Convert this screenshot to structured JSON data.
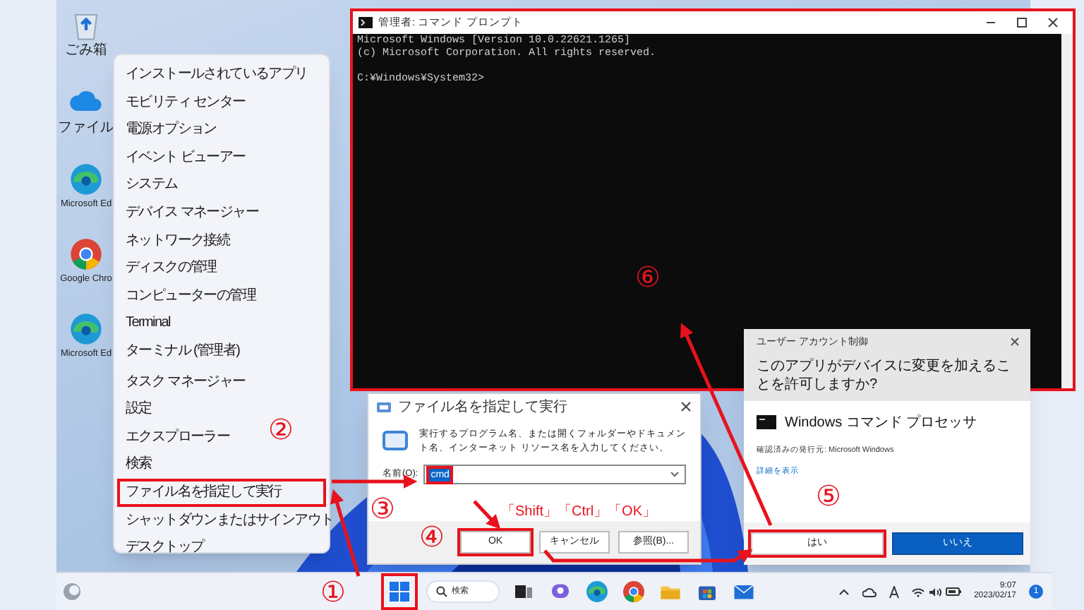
{
  "desktop_icons": [
    {
      "kind": "recycle",
      "label": "ごみ箱"
    },
    {
      "kind": "cloud",
      "label": "ファイル"
    },
    {
      "kind": "edge",
      "label": "Microsoft Ed"
    },
    {
      "kind": "chrome",
      "label": "Google Chro"
    },
    {
      "kind": "edge",
      "label": "Microsoft Ed"
    }
  ],
  "context_menu": {
    "sections": [
      [
        {
          "label": "インストールされているアプリ",
          "boxed": false
        },
        {
          "label": "モビリティ センター",
          "boxed": false
        },
        {
          "label": "電源オプション",
          "boxed": false
        },
        {
          "label": "イベント ビューアー",
          "boxed": false
        },
        {
          "label": "システム",
          "boxed": false
        },
        {
          "label": "デバイス マネージャー",
          "boxed": false
        },
        {
          "label": "ネットワーク接続",
          "boxed": false
        },
        {
          "label": "ディスクの管理",
          "boxed": false
        },
        {
          "label": "コンピューターの管理",
          "boxed": false
        },
        {
          "label": "Terminal",
          "boxed": false
        },
        {
          "label": "ターミナル (管理者)",
          "boxed": false
        }
      ],
      [
        {
          "label": "タスク マネージャー",
          "boxed": false
        },
        {
          "label": "設定",
          "boxed": false
        },
        {
          "label": "エクスプローラー",
          "boxed": false
        },
        {
          "label": "検索",
          "boxed": false
        },
        {
          "label": "ファイル名を指定して実行",
          "boxed": true
        },
        {
          "label": "シャットダウンまたはサインアウト",
          "boxed": false
        },
        {
          "label": "デスクトップ",
          "boxed": false
        }
      ]
    ]
  },
  "cmd_window": {
    "title": "管理者: コマンド プロンプト",
    "boxed": true,
    "lines": [
      "Microsoft Windows [Version 10.0.22621.1265]",
      "(c) Microsoft Corporation. All rights reserved."
    ],
    "prompt": "C:¥Windows¥System32>"
  },
  "run_dialog": {
    "title": "ファイル名を指定して実行",
    "description": "実行するプログラム名、または開くフォルダーやドキュメント名、インターネット リソース名を入力してください。",
    "field_label": "名前(O):",
    "value": "cmd",
    "value_boxed": true,
    "buttons": [
      {
        "label": "OK",
        "boxed": true
      },
      {
        "label": "キャンセル",
        "boxed": false
      },
      {
        "label": "参照(B)...",
        "boxed": false
      }
    ]
  },
  "uac_dialog": {
    "header": "ユーザー アカウント制御",
    "question": "このアプリがデバイスに変更を加えることを許可しますか?",
    "app_name": "Windows コマンド プロセッサ",
    "publisher": "確認済みの発行元: Microsoft Windows",
    "details_link": "詳細を表示",
    "buttons": [
      {
        "label": "はい",
        "kind": "secondary",
        "boxed": true
      },
      {
        "label": "いいえ",
        "kind": "primary",
        "boxed": false
      }
    ]
  },
  "taskbar": {
    "start_boxed": true,
    "search": "検索",
    "apps": [
      {
        "kind": "taskview"
      },
      {
        "kind": "chat"
      },
      {
        "kind": "edge"
      },
      {
        "kind": "chrome"
      },
      {
        "kind": "folder"
      },
      {
        "kind": "store"
      },
      {
        "kind": "mail"
      }
    ],
    "time": "9:07",
    "date": "2023/02/17",
    "notification_count": "1"
  },
  "annotations": {
    "markers": [
      "①",
      "②",
      "③",
      "④",
      "⑤",
      "⑥"
    ],
    "key_hint": "「Shift」「Ctrl」「OK」"
  }
}
